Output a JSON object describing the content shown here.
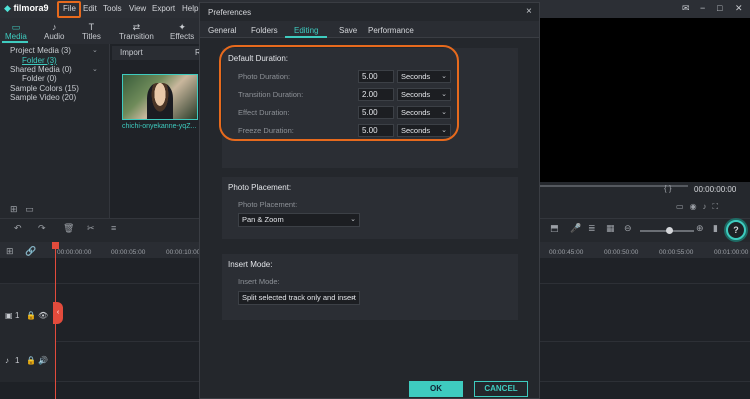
{
  "app": {
    "name": "filmora9"
  },
  "menu": [
    "File",
    "Edit",
    "Tools",
    "View",
    "Export",
    "Help"
  ],
  "window_buttons": {
    "minimize": "−",
    "restore": "□",
    "close": "✕",
    "extra": "▭"
  },
  "library_tabs": [
    {
      "label": "Media",
      "icon": "folder-icon"
    },
    {
      "label": "Audio",
      "icon": "music-icon"
    },
    {
      "label": "Titles",
      "icon": "text-icon"
    },
    {
      "label": "Transition",
      "icon": "transition-icon"
    },
    {
      "label": "Effects",
      "icon": "effects-icon"
    }
  ],
  "tree": {
    "items": [
      {
        "label": "Project Media (3)"
      },
      {
        "label": "Folder (3)"
      },
      {
        "label": "Shared Media (0)"
      },
      {
        "label": "Folder (0)"
      },
      {
        "label": "Sample Colors (15)"
      },
      {
        "label": "Sample Video (20)"
      }
    ]
  },
  "media": {
    "import_label": "Import",
    "extra_label": "R",
    "clip_name": "chichi-onyekanne-yqZ..."
  },
  "preview": {
    "timecode": "00:00:00:00",
    "brackets": "{  }"
  },
  "timeline": {
    "ticks": [
      "00:00:00:00",
      "00:00:05:00",
      "00:00:10:00",
      "00:00:45:00",
      "00:00:50:00",
      "00:00:55:00",
      "00:01:00:00"
    ],
    "video_track_num": "1",
    "audio_track_num": "1",
    "help_label": "?"
  },
  "dialog": {
    "title": "Preferences",
    "close": "×",
    "tabs": [
      "General",
      "Folders",
      "Editing",
      "Save",
      "Performance"
    ],
    "active_tab": "Editing",
    "default_duration": {
      "title": "Default Duration:",
      "rows": [
        {
          "label": "Photo Duration:",
          "value": "5.00",
          "unit": "Seconds"
        },
        {
          "label": "Transition Duration:",
          "value": "2.00",
          "unit": "Seconds"
        },
        {
          "label": "Effect Duration:",
          "value": "5.00",
          "unit": "Seconds"
        },
        {
          "label": "Freeze Duration:",
          "value": "5.00",
          "unit": "Seconds"
        }
      ]
    },
    "photo_placement": {
      "title": "Photo Placement:",
      "label": "Photo Placement:",
      "value": "Pan & Zoom"
    },
    "insert_mode": {
      "title": "Insert Mode:",
      "label": "Insert Mode:",
      "value": "Split selected track only and insert"
    },
    "ok_label": "OK",
    "cancel_label": "CANCEL"
  },
  "colors": {
    "accent": "#3ecbbf",
    "highlight": "#e76a1d",
    "playhead": "#e24b3c"
  }
}
